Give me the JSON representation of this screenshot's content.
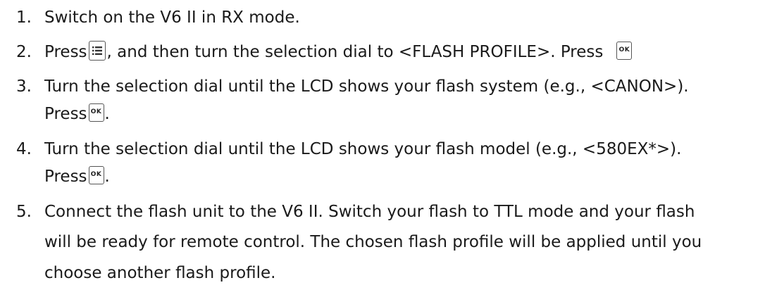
{
  "steps": [
    {
      "number": "1.",
      "text": "Switch on the V6 II in RX mode."
    },
    {
      "number": "2.",
      "text_a": "Press",
      "text_b": ", and then turn the selection dial to <FLASH PROFILE>. Press"
    },
    {
      "number": "3.",
      "line1": "Turn the selection dial until the LCD shows your flash system (e.g., <CANON>).",
      "press": "Press",
      "end": "."
    },
    {
      "number": "4.",
      "line1": "Turn the selection dial until the LCD shows your flash model (e.g., <580EX*>).",
      "press": "Press",
      "end": "."
    },
    {
      "number": "5.",
      "lines": [
        "Connect the flash unit to the V6 II. Switch your flash to TTL mode and your flash",
        "will be ready for remote control. The chosen flash profile will be applied until you",
        "choose another flash profile."
      ]
    }
  ],
  "keys": {
    "ok_label": "OK"
  },
  "icons": {
    "menu": "menu-button-icon",
    "ok": "ok-button-icon"
  }
}
